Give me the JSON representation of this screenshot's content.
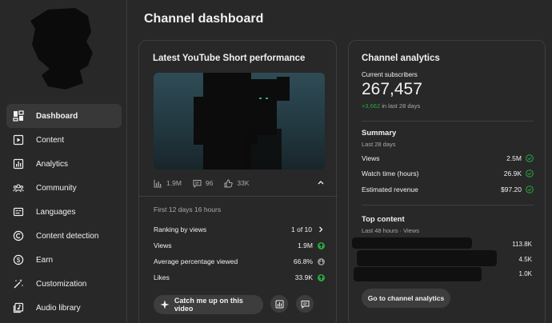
{
  "sidebar": {
    "items": [
      {
        "label": "Dashboard",
        "icon": "dashboard-icon",
        "active": true
      },
      {
        "label": "Content",
        "icon": "content-icon"
      },
      {
        "label": "Analytics",
        "icon": "analytics-icon"
      },
      {
        "label": "Community",
        "icon": "community-icon"
      },
      {
        "label": "Languages",
        "icon": "languages-icon"
      },
      {
        "label": "Content detection",
        "icon": "copyright-icon"
      },
      {
        "label": "Earn",
        "icon": "dollar-icon"
      },
      {
        "label": "Customization",
        "icon": "magic-wand-icon"
      },
      {
        "label": "Audio library",
        "icon": "audio-library-icon"
      }
    ]
  },
  "header": {
    "title": "Channel dashboard"
  },
  "short_card": {
    "title": "Latest YouTube Short performance",
    "stats": {
      "views": "1.9M",
      "comments": "96",
      "likes": "33K"
    },
    "period": "First 12 days 16 hours",
    "ranking": {
      "label": "Ranking by views",
      "value": "1 of 10"
    },
    "metrics": [
      {
        "label": "Views",
        "value": "1.9M",
        "trend": "up"
      },
      {
        "label": "Average percentage viewed",
        "value": "66.8%",
        "trend": "down"
      },
      {
        "label": "Likes",
        "value": "33.9K",
        "trend": "up"
      }
    ],
    "catch_up_label": "Catch me up on this video"
  },
  "analytics_card": {
    "title": "Channel analytics",
    "subscribers_label": "Current subscribers",
    "subscribers": "267,457",
    "delta": "+3,662",
    "delta_suffix": "in last 28 days",
    "summary_title": "Summary",
    "summary_period": "Last 28 days",
    "summary": [
      {
        "label": "Views",
        "value": "2.5M"
      },
      {
        "label": "Watch time (hours)",
        "value": "26.9K"
      },
      {
        "label": "Estimated revenue",
        "value": "$97.20"
      }
    ],
    "top_title": "Top content",
    "top_period": "Last 48 hours · Views",
    "top_values": [
      "113.8K",
      "4.5K",
      "1.0K"
    ],
    "button_label": "Go to channel analytics"
  },
  "colors": {
    "accent_green": "#2ba640",
    "card_border": "#3e3e3e",
    "background": "#282828"
  }
}
